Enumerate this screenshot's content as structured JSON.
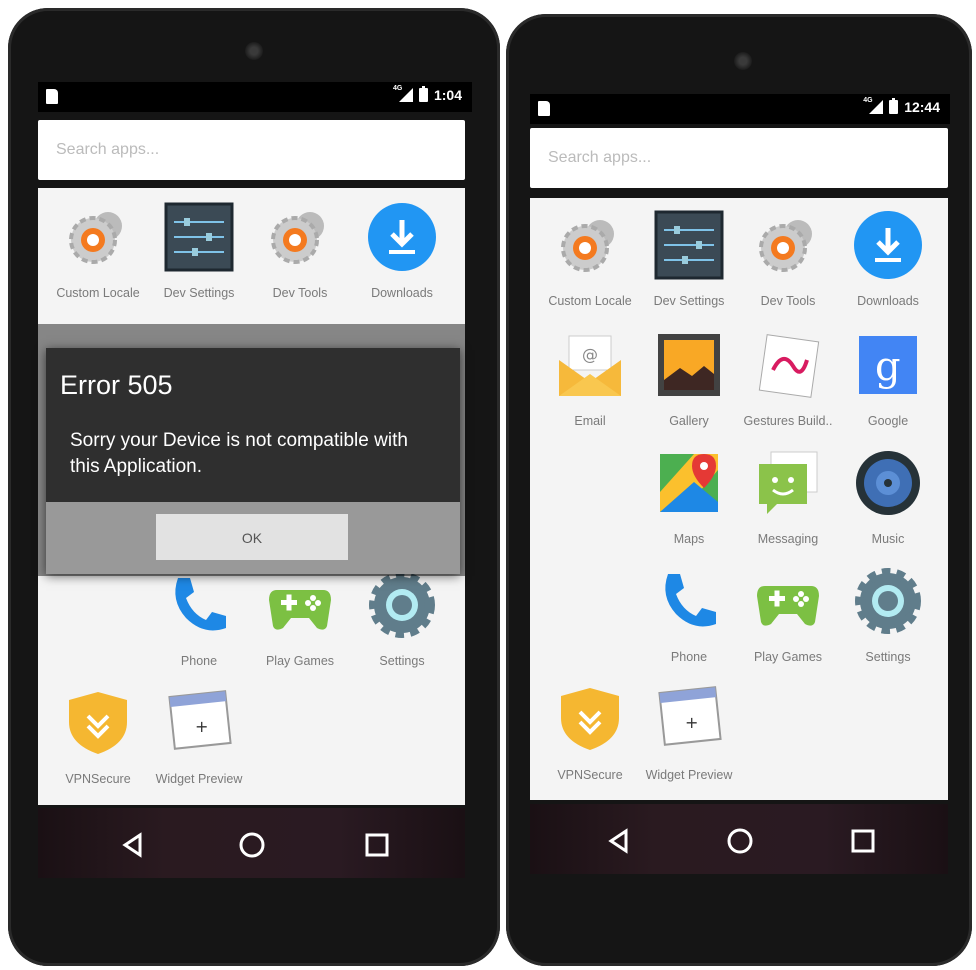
{
  "left_screen": {
    "status": {
      "time": "1:04",
      "network": "4G"
    },
    "search": {
      "placeholder": "Search apps..."
    },
    "apps_row1": [
      "Custom Locale",
      "Dev Settings",
      "Dev Tools",
      "Downloads"
    ],
    "apps_row4": [
      "Phone",
      "Play Games",
      "Settings"
    ],
    "apps_row5": [
      "VPNSecure",
      "Widget Preview"
    ],
    "dialog": {
      "title": "Error 505",
      "message": "Sorry your Device is not compatible with this Application.",
      "ok_label": "OK"
    }
  },
  "right_screen": {
    "status": {
      "time": "12:44",
      "network": "4G"
    },
    "search": {
      "placeholder": "Search apps..."
    },
    "apps_row1": [
      "Custom Locale",
      "Dev Settings",
      "Dev Tools",
      "Downloads"
    ],
    "apps_row2": [
      "Email",
      "Gallery",
      "Gestures Build..",
      "Google"
    ],
    "apps_row3": [
      "Maps",
      "Messaging",
      "Music"
    ],
    "apps_row4": [
      "Phone",
      "Play Games",
      "Settings"
    ],
    "apps_row5": [
      "VPNSecure",
      "Widget Preview"
    ]
  },
  "colors": {
    "drawer_bg": "#f4f4f4",
    "dialog_bg": "#2f2f2f",
    "accent_blue": "#2196f3",
    "play_green": "#7cc043"
  }
}
